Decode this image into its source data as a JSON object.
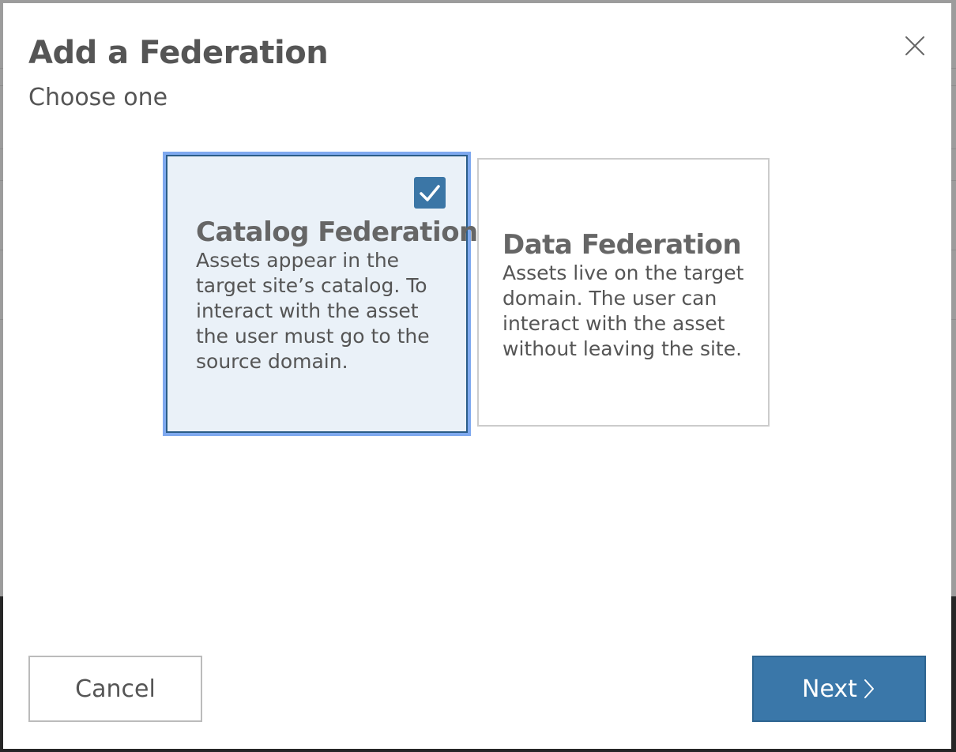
{
  "modal": {
    "title": "Add a Federation",
    "subtitle": "Choose one"
  },
  "options": [
    {
      "title": "Catalog Federation",
      "description": "Assets appear in the target site’s catalog. To interact with the asset the user must go to the source domain.",
      "selected": true
    },
    {
      "title": "Data Federation",
      "description": "Assets live on the target domain. The user can interact with the asset without leaving the site.",
      "selected": false
    }
  ],
  "footer": {
    "cancel_label": "Cancel",
    "next_label": "Next"
  },
  "icons": {
    "close": "close-icon",
    "check": "checkmark-icon",
    "next": "chevron-right-icon"
  },
  "colors": {
    "accent": "#3a77a9",
    "selected_card_bg": "#eaf1f8",
    "focus_ring": "#7fa9ef",
    "text": "#555555"
  }
}
